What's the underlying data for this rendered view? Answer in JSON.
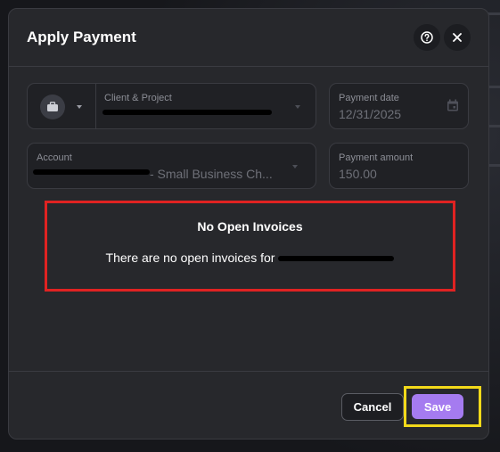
{
  "dialog": {
    "title": "Apply Payment",
    "help_icon": "question-circle-icon",
    "close_icon": "close-icon"
  },
  "client_project": {
    "label": "Client & Project",
    "icon": "briefcase-icon",
    "value": "",
    "value_redacted": true
  },
  "payment_date": {
    "label": "Payment date",
    "value": "12/31/2025",
    "icon": "calendar-icon"
  },
  "account": {
    "label": "Account",
    "value": "- Small Business Ch...",
    "value_redacted_prefix": true
  },
  "payment_amount": {
    "label": "Payment amount",
    "value": "150.00"
  },
  "notice": {
    "title": "No Open Invoices",
    "message": "There are no open invoices for",
    "client_redacted": true
  },
  "footer": {
    "cancel_label": "Cancel",
    "save_label": "Save"
  },
  "colors": {
    "accent": "#a57bf0",
    "highlight_red": "#e02222",
    "highlight_yellow": "#f2d91a",
    "dialog_bg": "#27282c"
  }
}
